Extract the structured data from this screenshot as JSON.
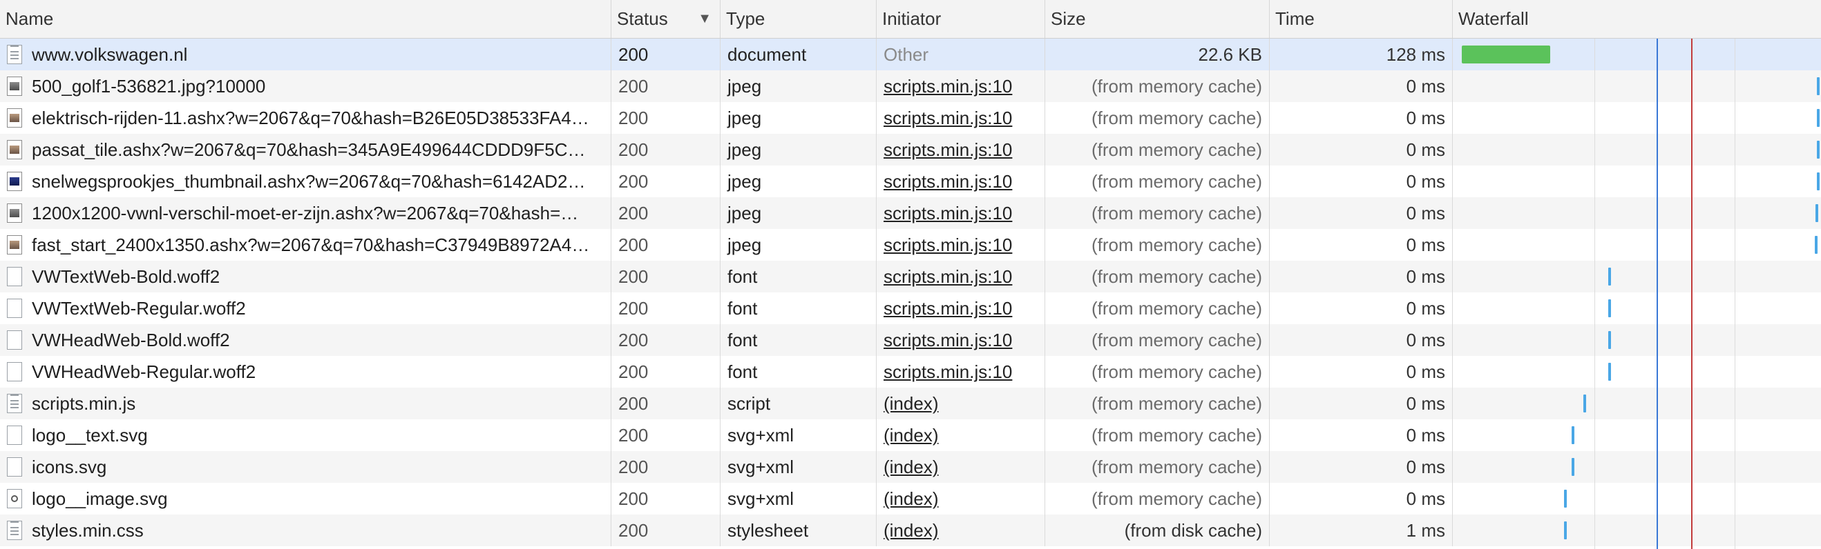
{
  "columns": {
    "name": "Name",
    "status": "Status",
    "type": "Type",
    "initiator": "Initiator",
    "size": "Size",
    "time": "Time",
    "waterfall": "Waterfall"
  },
  "sort_indicator": "▼",
  "rows": [
    {
      "name": "www.volkswagen.nl",
      "status": "200",
      "type": "document",
      "initiator": "Other",
      "size": "22.6 KB",
      "time": "128 ms",
      "icon": "document-icon"
    },
    {
      "name": "500_golf1-536821.jpg?10000",
      "status": "200",
      "type": "jpeg",
      "initiator": "scripts.min.js:10",
      "size": "(from memory cache)",
      "time": "0 ms",
      "icon": "image-icon"
    },
    {
      "name": "elektrisch-rijden-11.ashx?w=2067&q=70&hash=B26E05D38533FA4…",
      "status": "200",
      "type": "jpeg",
      "initiator": "scripts.min.js:10",
      "size": "(from memory cache)",
      "time": "0 ms",
      "icon": "image-icon"
    },
    {
      "name": "passat_tile.ashx?w=2067&q=70&hash=345A9E499644CDDD9F5C…",
      "status": "200",
      "type": "jpeg",
      "initiator": "scripts.min.js:10",
      "size": "(from memory cache)",
      "time": "0 ms",
      "icon": "image-icon"
    },
    {
      "name": "snelwegsprookjes_thumbnail.ashx?w=2067&q=70&hash=6142AD2…",
      "status": "200",
      "type": "jpeg",
      "initiator": "scripts.min.js:10",
      "size": "(from memory cache)",
      "time": "0 ms",
      "icon": "image-icon"
    },
    {
      "name": "1200x1200-vwnl-verschil-moet-er-zijn.ashx?w=2067&q=70&hash=…",
      "status": "200",
      "type": "jpeg",
      "initiator": "scripts.min.js:10",
      "size": "(from memory cache)",
      "time": "0 ms",
      "icon": "image-icon"
    },
    {
      "name": "fast_start_2400x1350.ashx?w=2067&q=70&hash=C37949B8972A4…",
      "status": "200",
      "type": "jpeg",
      "initiator": "scripts.min.js:10",
      "size": "(from memory cache)",
      "time": "0 ms",
      "icon": "image-icon"
    },
    {
      "name": "VWTextWeb-Bold.woff2",
      "status": "200",
      "type": "font",
      "initiator": "scripts.min.js:10",
      "size": "(from memory cache)",
      "time": "0 ms",
      "icon": "file-icon"
    },
    {
      "name": "VWTextWeb-Regular.woff2",
      "status": "200",
      "type": "font",
      "initiator": "scripts.min.js:10",
      "size": "(from memory cache)",
      "time": "0 ms",
      "icon": "file-icon"
    },
    {
      "name": "VWHeadWeb-Bold.woff2",
      "status": "200",
      "type": "font",
      "initiator": "scripts.min.js:10",
      "size": "(from memory cache)",
      "time": "0 ms",
      "icon": "file-icon"
    },
    {
      "name": "VWHeadWeb-Regular.woff2",
      "status": "200",
      "type": "font",
      "initiator": "scripts.min.js:10",
      "size": "(from memory cache)",
      "time": "0 ms",
      "icon": "file-icon"
    },
    {
      "name": "scripts.min.js",
      "status": "200",
      "type": "script",
      "initiator": "(index)",
      "size": "(from memory cache)",
      "time": "0 ms",
      "icon": "script-icon"
    },
    {
      "name": "logo__text.svg",
      "status": "200",
      "type": "svg+xml",
      "initiator": "(index)",
      "size": "(from memory cache)",
      "time": "0 ms",
      "icon": "file-icon"
    },
    {
      "name": "icons.svg",
      "status": "200",
      "type": "svg+xml",
      "initiator": "(index)",
      "size": "(from memory cache)",
      "time": "0 ms",
      "icon": "file-icon"
    },
    {
      "name": "logo__image.svg",
      "status": "200",
      "type": "svg+xml",
      "initiator": "(index)",
      "size": "(from memory cache)",
      "time": "0 ms",
      "icon": "svg-image-icon"
    },
    {
      "name": "styles.min.css",
      "status": "200",
      "type": "stylesheet",
      "initiator": "(index)",
      "size": "(from disk cache)",
      "time": "1 ms",
      "icon": "document-icon"
    }
  ],
  "colors": {
    "selected_row": "#dfeafb",
    "waterfall_bar": "#5bc25b",
    "waterfall_tick": "#4aa7e6",
    "dom_content_loaded_line": "#3a78d6",
    "load_line": "#c23b3b"
  }
}
